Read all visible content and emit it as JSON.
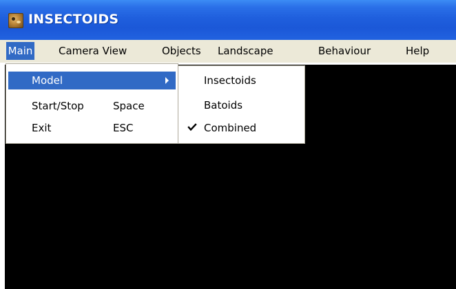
{
  "window": {
    "title": "INSECTOIDS",
    "app_icon": "insect-app-icon"
  },
  "menubar": {
    "items": [
      {
        "label": "Main"
      },
      {
        "label": "Camera View"
      },
      {
        "label": "Objects"
      },
      {
        "label": "Landscape"
      },
      {
        "label": "Behaviour"
      },
      {
        "label": "Help"
      }
    ]
  },
  "main_menu": {
    "items": [
      {
        "label": "Model",
        "shortcut": "",
        "has_submenu": true
      },
      {
        "label": "Start/Stop",
        "shortcut": "Space"
      },
      {
        "label": "Exit",
        "shortcut": "ESC"
      }
    ]
  },
  "model_submenu": {
    "items": [
      {
        "label": "Insectoids",
        "checked": false
      },
      {
        "label": "Batoids",
        "checked": false
      },
      {
        "label": "Combined",
        "checked": true
      }
    ]
  },
  "colors": {
    "titlebar": "#2162e0",
    "menu_highlight": "#316ac5",
    "menubar_bg": "#ece9d8",
    "viewport_bg": "#000000"
  }
}
